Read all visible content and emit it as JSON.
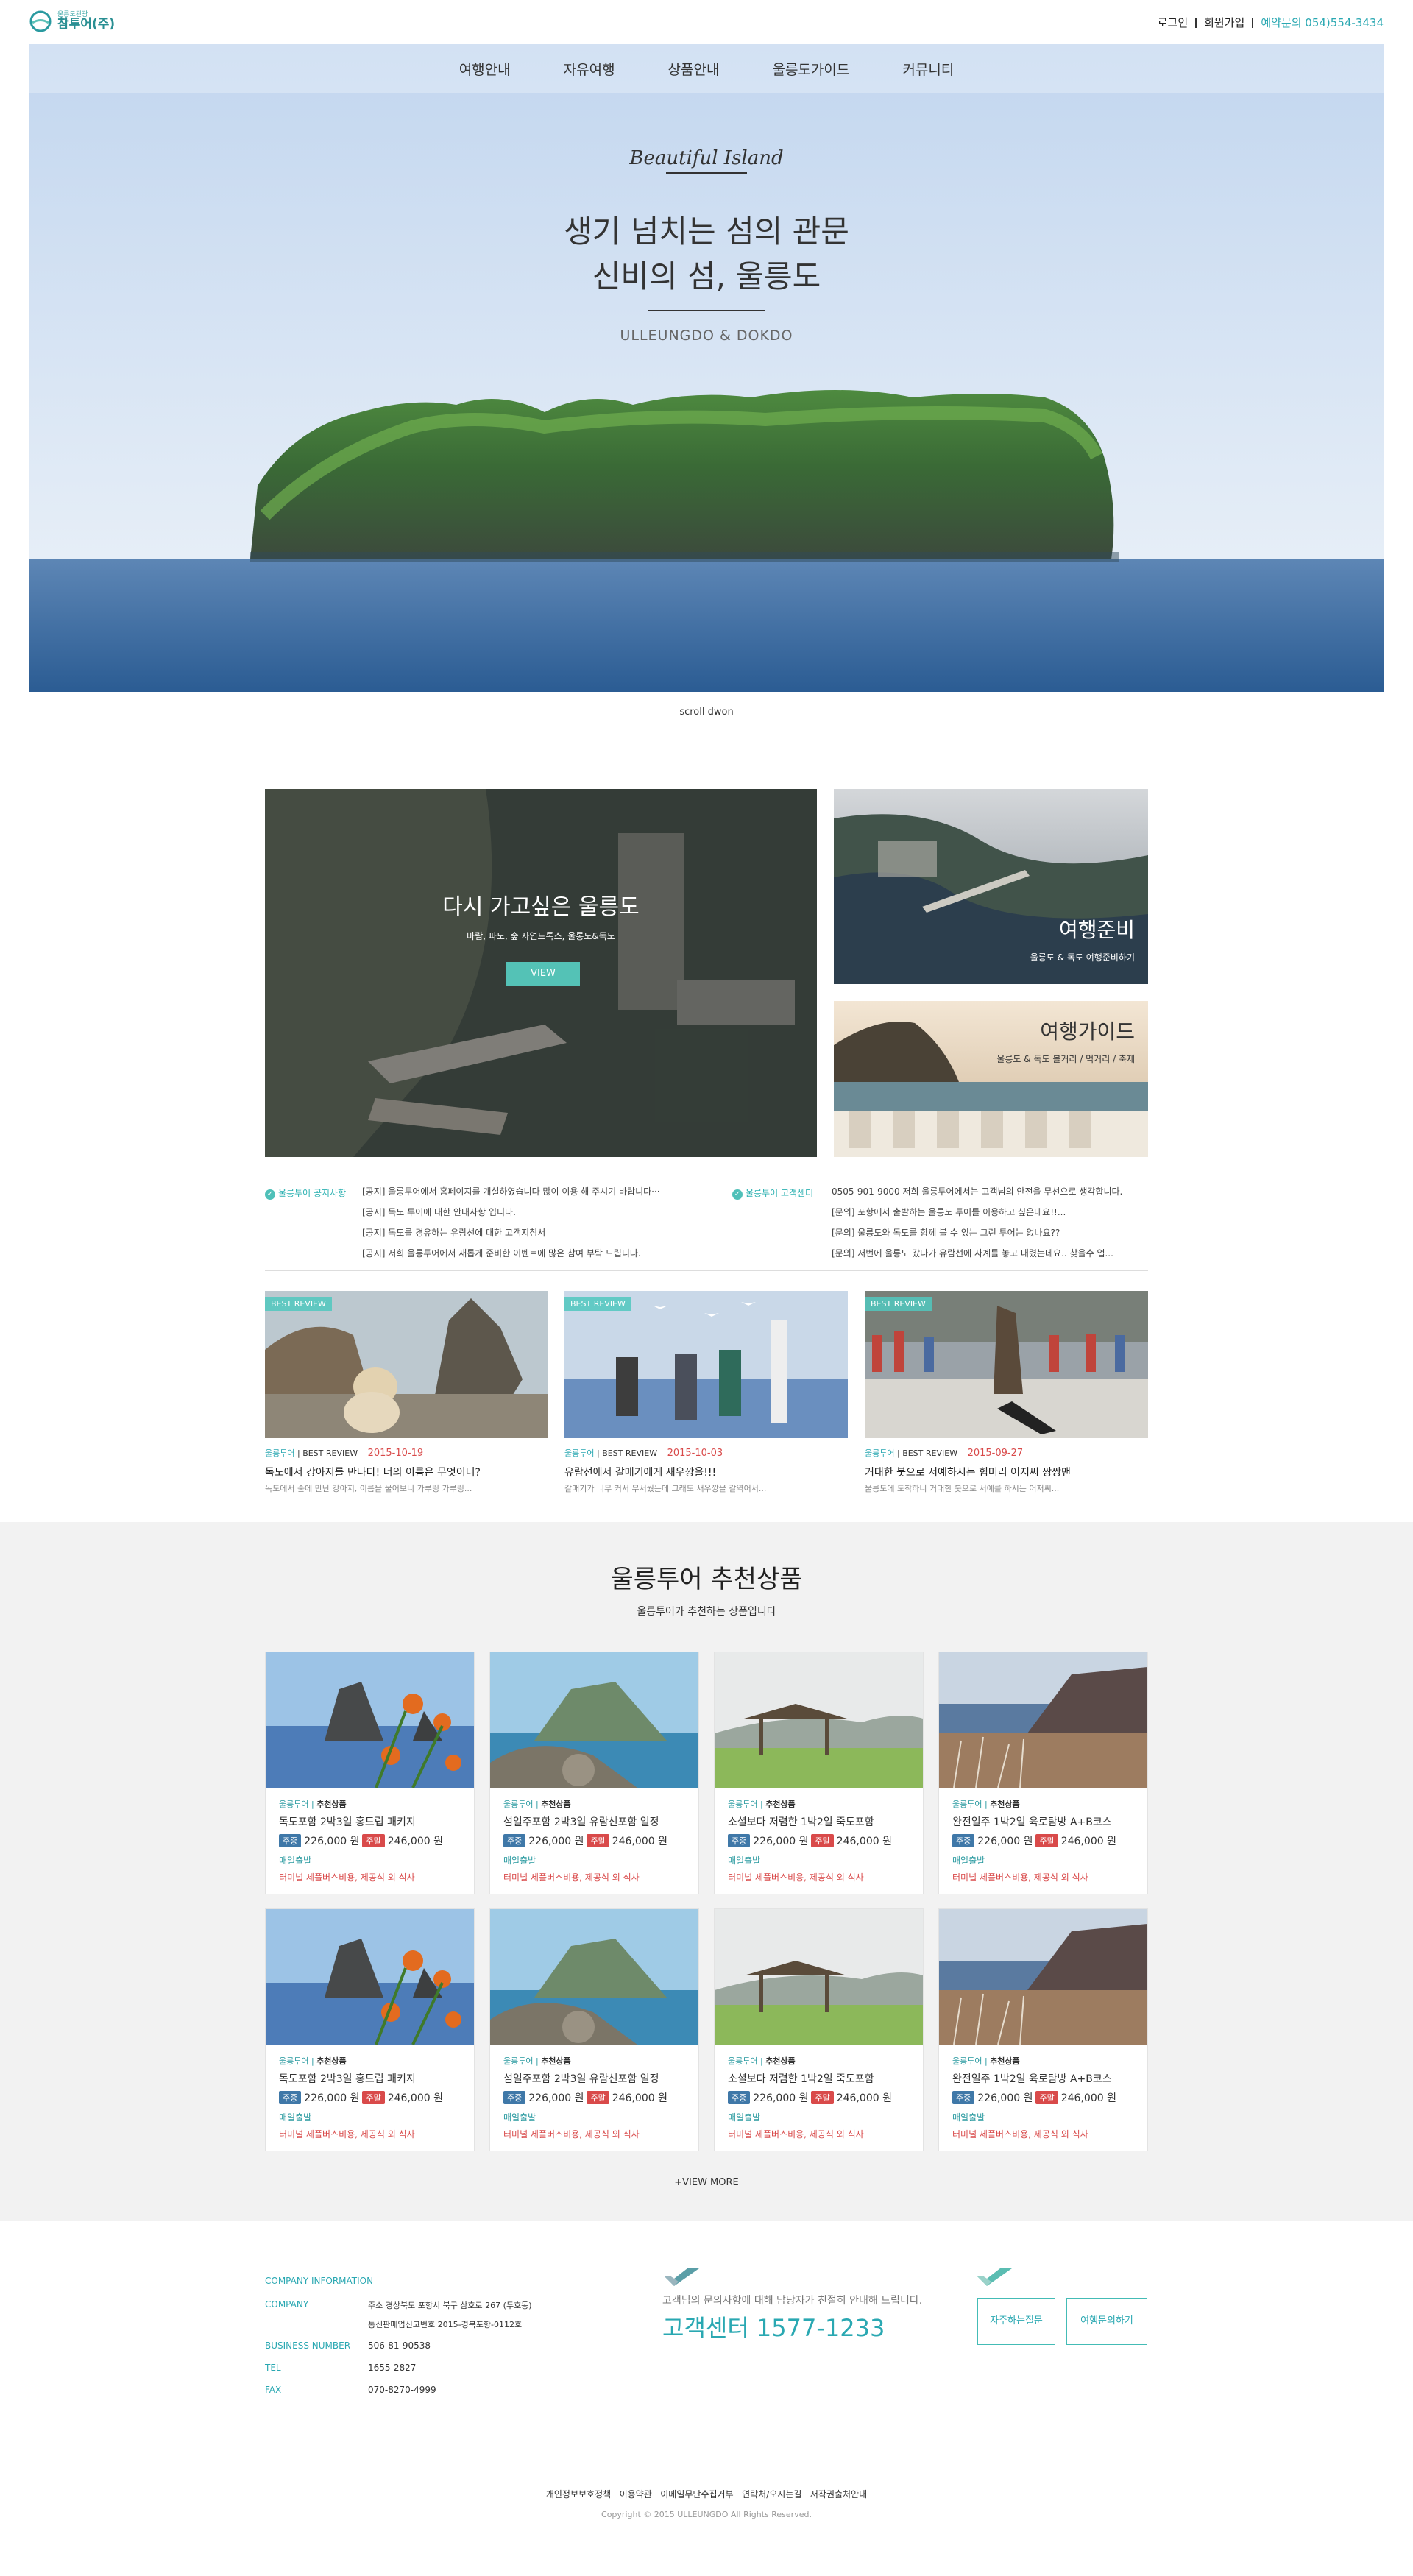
{
  "header": {
    "logo_small": "울릉도관광",
    "logo_main": "참투어(주)",
    "login": "로그인",
    "signup": "회원가입",
    "reservation": "예약문의 054)554-3434"
  },
  "nav": {
    "items": [
      "여행안내",
      "자유여행",
      "상품안내",
      "울릉도가이드",
      "커뮤니티"
    ]
  },
  "hero": {
    "script_title": "Beautiful Island",
    "title_line1": "생기 넘치는 섬의 관문",
    "title_line2": "신비의 섬, 울릉도",
    "subtitle": "ULLEUNGDO & DOKDO",
    "scroll_label": "scroll dwon"
  },
  "feature": {
    "main_title": "다시 가고싶은 울릉도",
    "main_sub": "바람, 파도, 숲 자연드톡스, 울롱도&독도",
    "main_btn": "VIEW",
    "prep_title": "여행준비",
    "prep_sub": "울릉도 & 독도 여행준비하기",
    "guide_title": "여행가이드",
    "guide_sub": "울릉도 & 독도 볼거리 / 먹거리 / 축제"
  },
  "notices": {
    "left_label": "울릉투어 공지사항",
    "left_rows": [
      "[공지]  울릉투어에서 홈페이지를 개설하였습니다 많이 이용 해 주시기 바랍니다···",
      "[공지]  독도 투어에 대한 안내사항 입니다.",
      "[공지]  독도를 경유하는 유람선에 대한 고객지침서",
      "[공지]  저희 울릉투어에서 새롭게 준비한 이벤트에 많은 참여 부탁 드립니다."
    ],
    "right_label": "울릉투어 고객센터",
    "right_rows": [
      "0505-901-9000  저희 울릉투어에서는 고객님의 안전을 무선으로 생각합니다.",
      "[문의]  포항에서 출발하는 울릉도 투어를 이용하고 싶은데요!!...",
      "[문의]  울릉도와 독도를 함께 볼 수 있는 그런 투어는 없나요??",
      "[문의]  저번에 울릉도 갔다가 유람선에 사계를 놓고 내렸는데요.. 찾을수 업..."
    ]
  },
  "reviews": [
    {
      "tag": "BEST REVIEW",
      "meta_brand": "울릉투어",
      "meta_type": "BEST REVIEW",
      "date": "2015-10-19",
      "title": "독도에서 강아지를 만나다! 너의 이름은 무엇이니?",
      "desc": "독도에서 숲에 만난 강아지, 이름을 물어보니 가루링 가루링..."
    },
    {
      "tag": "BEST REVIEW",
      "meta_brand": "울릉투어",
      "meta_type": "BEST REVIEW",
      "date": "2015-10-03",
      "title": "유람선에서 갈매기에게 새우깡을!!!",
      "desc": "갈매기가 너무 커서 무서웠는데 그래도 새우깡을 갈역어서..."
    },
    {
      "tag": "BEST REVIEW",
      "meta_brand": "울릉투어",
      "meta_type": "BEST REVIEW",
      "date": "2015-09-27",
      "title": "거대한 붓으로 서예하시는 힘머리 어저씨 짱짱맨",
      "desc": "울릉도에 도착하니 거대한 붓으로 서예를 하시는 어저씨..."
    }
  ],
  "recommend": {
    "title": "울릉투어 추천상품",
    "subtitle": "울릉투어가 추천하는 상품입니다",
    "more": "+VIEW MORE",
    "products": [
      {
        "brand": "울릉투어",
        "cat": "추천상품",
        "name": "독도포함 2박3일 홍드립 패키지",
        "weekday_label": "주중",
        "weekday": "226,000 원",
        "weekend_label": "주말",
        "weekend": "246,000 원",
        "depart": "매일출발",
        "note": "터미널 세플버스비용, 제공식 외 식사",
        "img": "lily"
      },
      {
        "brand": "울릉투어",
        "cat": "추천상품",
        "name": "섬일주포함 2박3일 유람선포함 일정",
        "weekday_label": "주중",
        "weekday": "226,000 원",
        "weekend_label": "주말",
        "weekend": "246,000 원",
        "depart": "매일출발",
        "note": "터미널 세플버스비용, 제공식 외 식사",
        "img": "rocks"
      },
      {
        "brand": "울릉투어",
        "cat": "추천상품",
        "name": "소셜보다 저렴한 1박2일 죽도포함",
        "weekday_label": "주중",
        "weekday": "226,000 원",
        "weekend_label": "주말",
        "weekend": "246,000 원",
        "depart": "매일출발",
        "note": "터미널 세플버스비용, 제공식 외 식사",
        "img": "pavilion"
      },
      {
        "brand": "울릉투어",
        "cat": "추천상품",
        "name": "완전일주 1박2일 육로탐방 A+B코스",
        "weekday_label": "주중",
        "weekday": "226,000 원",
        "weekend_label": "주말",
        "weekend": "246,000 원",
        "depart": "매일출발",
        "note": "터미널 세플버스비용, 제공식 외 식사",
        "img": "reeds"
      },
      {
        "brand": "울릉투어",
        "cat": "추천상품",
        "name": "독도포함 2박3일 홍드립 패키지",
        "weekday_label": "주중",
        "weekday": "226,000 원",
        "weekend_label": "주말",
        "weekend": "246,000 원",
        "depart": "매일출발",
        "note": "터미널 세플버스비용, 제공식 외 식사",
        "img": "lily"
      },
      {
        "brand": "울릉투어",
        "cat": "추천상품",
        "name": "섬일주포함 2박3일 유람선포함 일정",
        "weekday_label": "주중",
        "weekday": "226,000 원",
        "weekend_label": "주말",
        "weekend": "246,000 원",
        "depart": "매일출발",
        "note": "터미널 세플버스비용, 제공식 외 식사",
        "img": "rocks"
      },
      {
        "brand": "울릉투어",
        "cat": "추천상품",
        "name": "소셜보다 저렴한 1박2일 죽도포함",
        "weekday_label": "주중",
        "weekday": "226,000 원",
        "weekend_label": "주말",
        "weekend": "246,000 원",
        "depart": "매일출발",
        "note": "터미널 세플버스비용, 제공식 외 식사",
        "img": "pavilion"
      },
      {
        "brand": "울릉투어",
        "cat": "추천상품",
        "name": "완전일주 1박2일 육로탐방 A+B코스",
        "weekday_label": "주중",
        "weekday": "226,000 원",
        "weekend_label": "주말",
        "weekend": "246,000 원",
        "depart": "매일출발",
        "note": "터미널 세플버스비용, 제공식 외 식사",
        "img": "reeds"
      }
    ]
  },
  "company": {
    "heading": "COMPANY INFORMATION",
    "company_label": "COMPANY",
    "company_val1": "주소 경상북도 포항시 북구 삼호로 267 (두호동)",
    "company_val2": "통신판매업신고번호 2015-경북포항-0112호",
    "biz_label": "BUSINESS NUMBER",
    "biz_val": "506-81-90538",
    "tel_label": "TEL",
    "tel_val": "1655-2827",
    "fax_label": "FAX",
    "fax_val": "070-8270-4999"
  },
  "service": {
    "desc": "고객님의 문의사항에 대해 담당자가 친절히 안내해 드립니다.",
    "title": "고객센터 1577-1233",
    "faq": "자주하는질문",
    "inquiry": "여행문의하기"
  },
  "footer": {
    "links": [
      "개인정보보호정책",
      "이용약관",
      "이메일무단수집거부",
      "연락처/오시는길",
      "저작권출처안내"
    ],
    "copyright": "Copyright © 2015 ULLEUNGDO  All Rights Reserved."
  },
  "colors": {
    "accent": "#2aa8b2",
    "badge_blue": "#3f78a8",
    "badge_red": "#d94a4a",
    "rec_bg": "#f2f2f2"
  }
}
